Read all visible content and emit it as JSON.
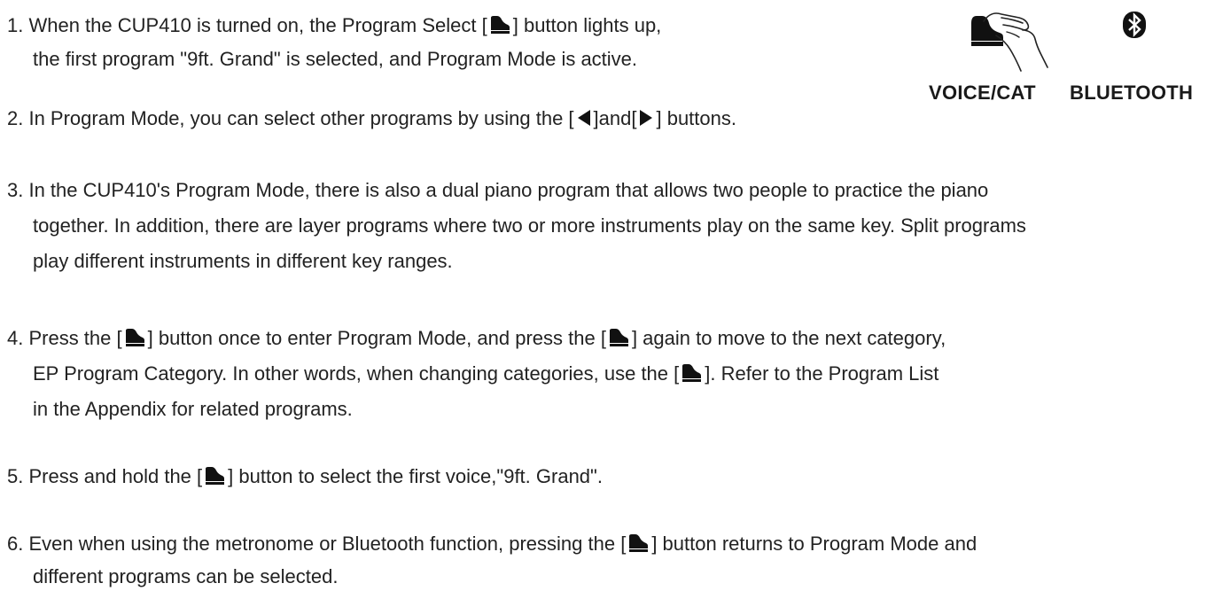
{
  "icons": {
    "program_select": "grand-piano-button-icon",
    "left": "left-triangle-icon",
    "right": "right-triangle-icon",
    "bluetooth": "bluetooth-icon",
    "hand": "finger-press-icon"
  },
  "panel": {
    "voice_label": "VOICE/CAT",
    "bluetooth_label": "BLUETOOTH"
  },
  "items": [
    {
      "l1a": "1. When the CUP410 is turned on, the Program Select  [",
      "l1b": "] button lights up,",
      "l2": "the first program \"9ft. Grand\" is selected, and Program Mode is active."
    },
    {
      "a": "2. In Program Mode, you can select other programs by using the [",
      "b": "]and[",
      "c": "] buttons."
    },
    {
      "l1": "3. In the CUP410's Program Mode, there is also a dual piano program that allows two people to practice the piano",
      "l2": "together. In addition, there are layer programs where two or more instruments play on the same key. Split programs",
      "l3": "play different instruments in different key ranges."
    },
    {
      "l1a": "4. Press the [",
      "l1b": "] button once to enter Program Mode, and press the [",
      "l1c": "] again to move to the next category,",
      "l2a": "EP Program Category. In other words, when changing categories, use the [",
      "l2b": "]. Refer to the Program List",
      "l3": "in the Appendix for related programs."
    },
    {
      "a": "5. Press and hold the [",
      "b": "] button to select the first voice,\"9ft. Grand\"."
    },
    {
      "l1a": "6. Even when using the metronome or Bluetooth function, pressing the [",
      "l1b": "] button returns to Program Mode and",
      "l2": "different programs can be selected."
    }
  ]
}
